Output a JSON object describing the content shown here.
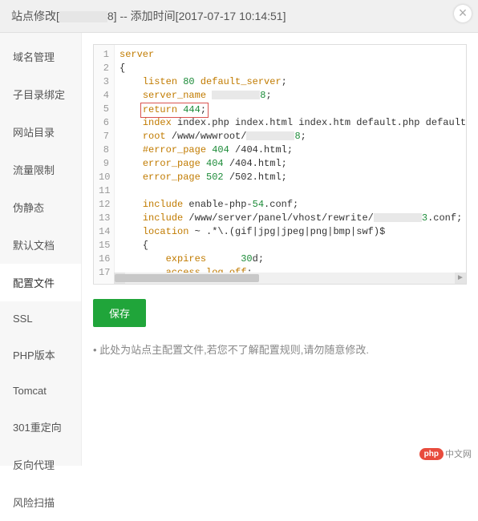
{
  "header": {
    "prefix": "站点修改[",
    "id_suffix": "8]",
    "add_time_label": " -- 添加时间[2017-07-17 10:14:51]"
  },
  "sidebar": {
    "items": [
      {
        "label": "域名管理"
      },
      {
        "label": "子目录绑定"
      },
      {
        "label": "网站目录"
      },
      {
        "label": "流量限制"
      },
      {
        "label": "伪静态"
      },
      {
        "label": "默认文档"
      },
      {
        "label": "配置文件"
      },
      {
        "label": "SSL"
      },
      {
        "label": "PHP版本"
      },
      {
        "label": "Tomcat"
      },
      {
        "label": "301重定向"
      },
      {
        "label": "反向代理"
      },
      {
        "label": "风险扫描"
      }
    ],
    "active_index": 6
  },
  "editor": {
    "lines": [
      {
        "n": 1,
        "tokens": [
          [
            "kw",
            "server"
          ]
        ]
      },
      {
        "n": 2,
        "tokens": [
          [
            "",
            "{"
          ]
        ]
      },
      {
        "n": 3,
        "tokens": [
          [
            "",
            "    "
          ],
          [
            "kw",
            "listen "
          ],
          [
            "num",
            "80 "
          ],
          [
            "kw",
            "default_server"
          ],
          [
            "",
            ";"
          ]
        ]
      },
      {
        "n": 4,
        "tokens": [
          [
            "",
            "    "
          ],
          [
            "kw",
            "server_name "
          ],
          [
            "redact",
            ""
          ],
          [
            "num",
            "8"
          ],
          [
            "",
            ";"
          ]
        ]
      },
      {
        "n": 5,
        "tokens": [
          [
            "",
            "    "
          ],
          [
            "hl_open",
            ""
          ],
          [
            "kw",
            "return "
          ],
          [
            "num",
            "444"
          ],
          [
            "",
            ";"
          ],
          [
            "hl_close",
            ""
          ]
        ]
      },
      {
        "n": 6,
        "tokens": [
          [
            "",
            "    "
          ],
          [
            "kw",
            "index "
          ],
          [
            "path",
            "index.php index.html index.htm default.php default.htm defau"
          ]
        ]
      },
      {
        "n": 7,
        "tokens": [
          [
            "",
            "    "
          ],
          [
            "kw",
            "root "
          ],
          [
            "path",
            "/www/wwwroot/"
          ],
          [
            "redact",
            ""
          ],
          [
            "num",
            "8"
          ],
          [
            "",
            ";"
          ]
        ]
      },
      {
        "n": 8,
        "tokens": [
          [
            "",
            "    "
          ],
          [
            "kw",
            "#error_page "
          ],
          [
            "num",
            "404 "
          ],
          [
            "path",
            "/404.html;"
          ]
        ]
      },
      {
        "n": 9,
        "tokens": [
          [
            "",
            "    "
          ],
          [
            "kw",
            "error_page "
          ],
          [
            "num",
            "404 "
          ],
          [
            "path",
            "/404.html;"
          ]
        ]
      },
      {
        "n": 10,
        "tokens": [
          [
            "",
            "    "
          ],
          [
            "kw",
            "error_page "
          ],
          [
            "num",
            "502 "
          ],
          [
            "path",
            "/502.html;"
          ]
        ]
      },
      {
        "n": 11,
        "tokens": [
          [
            "",
            ""
          ]
        ]
      },
      {
        "n": 12,
        "tokens": [
          [
            "",
            "    "
          ],
          [
            "kw",
            "include "
          ],
          [
            "path",
            "enable-php-"
          ],
          [
            "num",
            "54"
          ],
          [
            "path",
            ".conf;"
          ]
        ]
      },
      {
        "n": 13,
        "tokens": [
          [
            "",
            "    "
          ],
          [
            "kw",
            "include "
          ],
          [
            "path",
            "/www/server/panel/vhost/rewrite/"
          ],
          [
            "redact",
            ""
          ],
          [
            "num",
            "3"
          ],
          [
            "path",
            ".conf;"
          ]
        ]
      },
      {
        "n": 14,
        "tokens": [
          [
            "",
            "    "
          ],
          [
            "kw",
            "location "
          ],
          [
            "path",
            "~ .*\\.(gif|jpg|jpeg|png|bmp|swf)$"
          ]
        ]
      },
      {
        "n": 15,
        "tokens": [
          [
            "",
            "    {"
          ]
        ]
      },
      {
        "n": 16,
        "tokens": [
          [
            "",
            "        "
          ],
          [
            "kw",
            "expires      "
          ],
          [
            "num",
            "30"
          ],
          [
            "path",
            "d;"
          ]
        ]
      },
      {
        "n": 17,
        "tokens": [
          [
            "",
            "        "
          ],
          [
            "kw",
            "access_log off"
          ],
          [
            "",
            ";"
          ]
        ]
      }
    ]
  },
  "buttons": {
    "save": "保存"
  },
  "hint_text": "此处为站点主配置文件,若您不了解配置规则,请勿随意修改.",
  "watermark": {
    "badge": "php",
    "text": "中文网"
  }
}
